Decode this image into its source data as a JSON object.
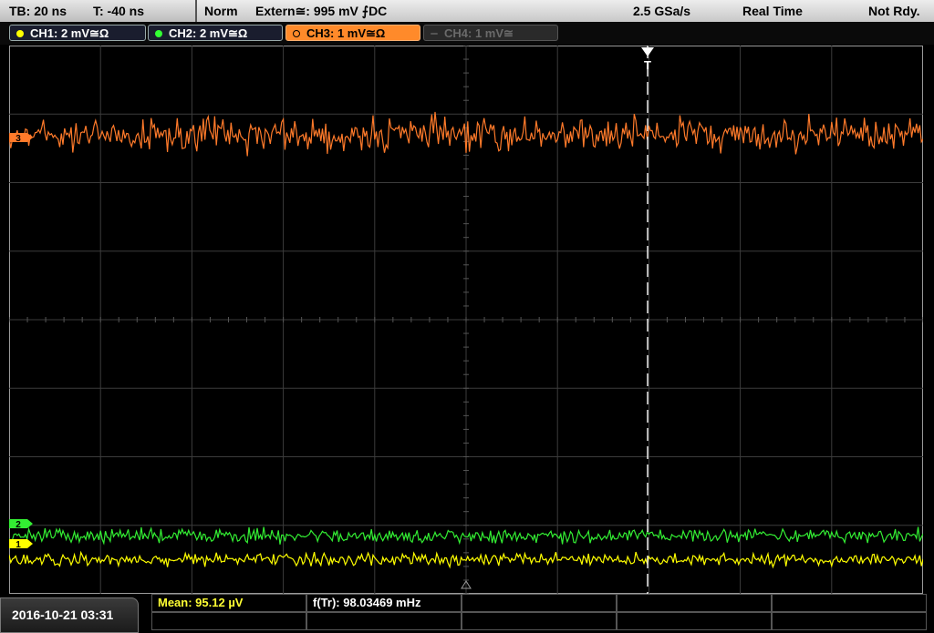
{
  "status_bar": {
    "timebase": "TB: 20 ns",
    "trigger_time": "T: -40 ns",
    "trigger_mode": "Norm",
    "trigger_source": "Extern≅: 995 mV ⨍DC",
    "sample_rate": "2.5 GSa/s",
    "acquisition": "Real Time",
    "state": "Not Rdy."
  },
  "channels": [
    {
      "label": "CH1: 2 mV≅Ω",
      "color": "#ffff00",
      "state": "on"
    },
    {
      "label": "CH2: 2 mV≅Ω",
      "color": "#33ff33",
      "state": "on"
    },
    {
      "label": "CH3: 1 mV≅Ω",
      "color": "#ff8a2a",
      "state": "selected"
    },
    {
      "label": "CH4: 1 mV≅",
      "color": "#6a6a6a",
      "state": "off"
    }
  ],
  "trigger_marker": "T",
  "channel_markers": {
    "ch1": "1",
    "ch2": "2",
    "ch3": "3"
  },
  "waveforms": {
    "ch3": {
      "color": "#ff7a2a",
      "center_div": 1.3,
      "amp_div": 0.35
    },
    "ch2": {
      "color": "#33ee33",
      "center_div": 7.15,
      "amp_div": 0.15
    },
    "ch1": {
      "color": "#ffff00",
      "center_div": 7.5,
      "amp_div": 0.13
    }
  },
  "measurements": {
    "mean": "Mean: 95.12 µV",
    "freq": "f(Tr): 98.03469 mHz"
  },
  "datetime": "2016-10-21 03:31"
}
